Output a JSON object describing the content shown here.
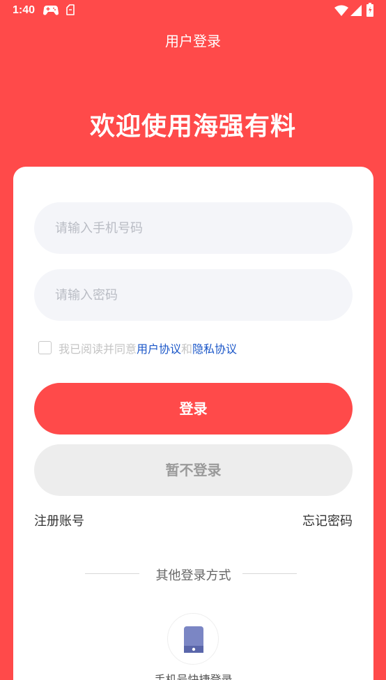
{
  "status_bar": {
    "time": "1:40"
  },
  "header": {
    "title": "用户登录",
    "welcome": "欢迎使用海强有料"
  },
  "form": {
    "phone_placeholder": "请输入手机号码",
    "password_placeholder": "请输入密码",
    "agree_prefix": "我已阅读并同意",
    "user_agreement": "用户协议",
    "and_text": "和",
    "privacy_policy": "隐私协议",
    "login_label": "登录",
    "skip_label": "暂不登录",
    "register_label": "注册账号",
    "forgot_label": "忘记密码"
  },
  "other_login": {
    "title": "其他登录方式",
    "quick_label": "手机号快捷登录"
  },
  "colors": {
    "brand": "#ff4a4a",
    "link": "#1a56c8",
    "input_bg": "#f4f5f9",
    "phone_icon": "#7b86c4"
  },
  "icons": [
    "gamepad-icon",
    "clipboard-icon",
    "wifi-icon",
    "signal-icon",
    "battery-icon",
    "checkbox-icon",
    "phone-icon"
  ]
}
